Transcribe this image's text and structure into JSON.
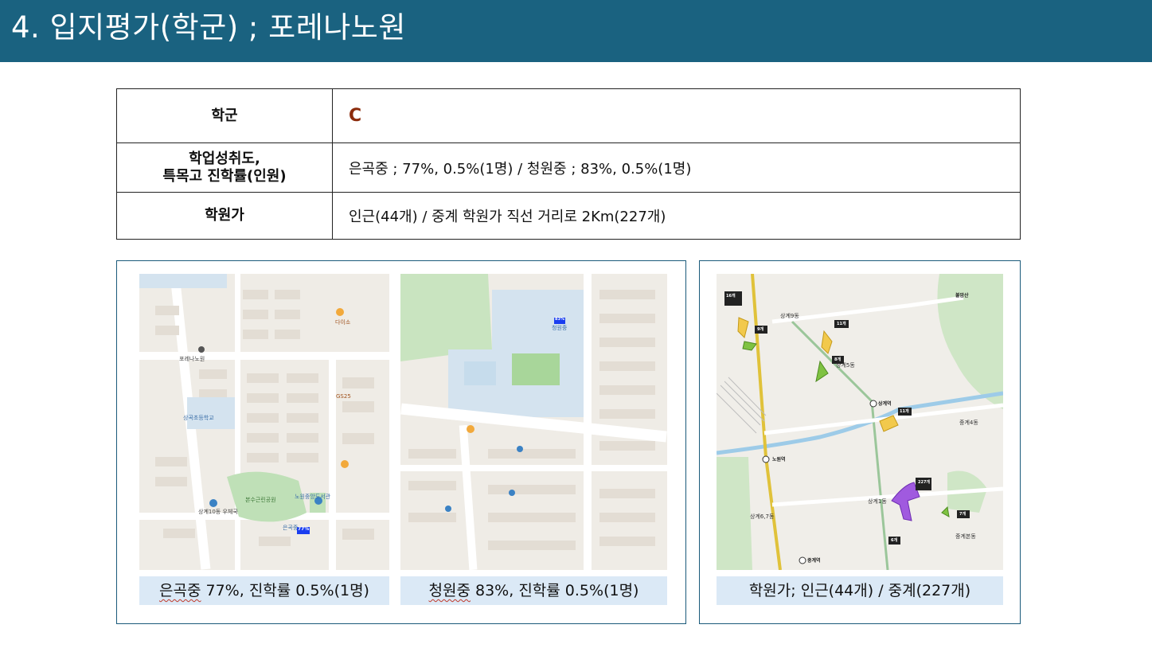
{
  "header": {
    "title": "4. 입지평가(학군) ; 포레나노원"
  },
  "table": {
    "rows": [
      {
        "label": "학군",
        "value": "C"
      },
      {
        "label_line1": "학업성취도,",
        "label_line2": "특목고 진학률(인원)",
        "value": "은곡중 ; 77%, 0.5%(1명) / 청원중 ; 83%, 0.5%(1명)"
      },
      {
        "label": "학원가",
        "value": "인근(44개) / 중계 학원가 직선 거리로 2Km(227개)"
      }
    ]
  },
  "maps": {
    "map1": {
      "caption_school": "은곡중",
      "caption_rest": " 77%, 진학률 0.5%(1명)",
      "labels": {
        "school": "상곡초등학교",
        "middle": "은곡중",
        "badge": "77%",
        "apt": "포레나노원",
        "park": "본수근린공원",
        "library": "노원중앙도서관",
        "store1": "GS25",
        "store2": "다이소",
        "post": "상계10동 우체국"
      }
    },
    "map2": {
      "caption_school": "청원중",
      "caption_rest": " 83%, 진학률 0.5%(1명)",
      "labels": {
        "school": "청원중",
        "badge": "83%"
      }
    },
    "map3": {
      "caption": "학원가; 인근(44개) / 중계(227개)",
      "labels": {
        "badge_16": "16개",
        "badge_9": "9개",
        "badge_11a": "11개",
        "badge_8": "8개",
        "badge_11b": "11개",
        "badge_227": "227개",
        "badge_7": "7개",
        "badge_6": "6개",
        "district1": "상계9동",
        "district2": "상계5동",
        "district3": "상계1동",
        "district4": "중계4동",
        "district5": "상계6,7동",
        "district6": "중계본동",
        "station1": "노원역",
        "station2": "상계역",
        "station3": "중계역",
        "mountain": "불암산"
      }
    }
  },
  "colors": {
    "header_bg": "#1a6280",
    "grade": "#8b2b0b",
    "caption_bg": "#dbe9f6",
    "panel_border": "#1a5a7a",
    "academy_purple": "#a05adf",
    "academy_yellow": "#f2c94c",
    "academy_green": "#7fc242"
  }
}
